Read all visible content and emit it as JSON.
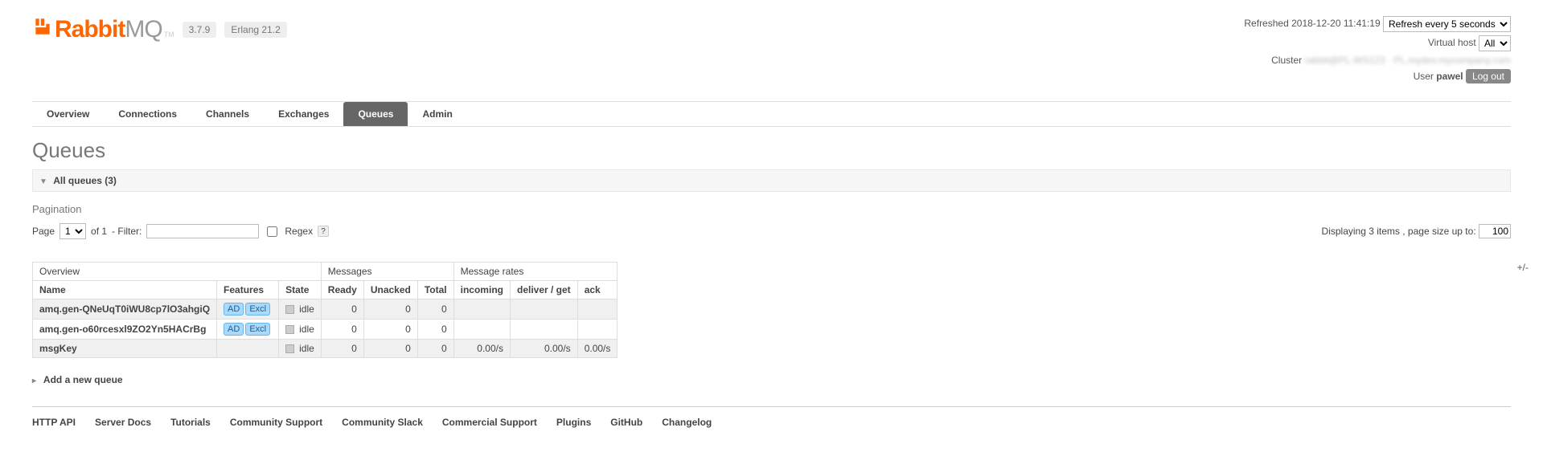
{
  "header": {
    "logoLeft": "Rabbit",
    "logoRight": "MQ",
    "tm": "TM",
    "versions": {
      "rabbit": "3.7.9",
      "erlang": "Erlang 21.2"
    },
    "refreshedPrefix": "Refreshed",
    "refreshedTime": "2018-12-20 11:41:19",
    "refreshOptions": [
      "Refresh every 5 seconds"
    ],
    "vhostLabel": "Virtual host",
    "vhostOptions": [
      "All"
    ],
    "clusterLabel": "Cluster",
    "clusterValue": "rabbit@PL-WS123 · PL.mydev.mycompany.com",
    "userLabel": "User",
    "userName": "pawel",
    "logout": "Log out"
  },
  "tabs": [
    "Overview",
    "Connections",
    "Channels",
    "Exchanges",
    "Queues",
    "Admin"
  ],
  "activeTab": "Queues",
  "pageTitle": "Queues",
  "allQueuesLabel": "All queues (3)",
  "paginationTitle": "Pagination",
  "pagination": {
    "pageLabel": "Page",
    "pageValue": "1",
    "ofLabel": "of 1",
    "filterLabel": "- Filter:",
    "filterValue": "",
    "regexLabel": "Regex",
    "displaying": "Displaying 3 items , page size up to:",
    "pageSize": "100"
  },
  "table": {
    "groups": {
      "overview": "Overview",
      "messages": "Messages",
      "rates": "Message rates"
    },
    "headers": {
      "name": "Name",
      "features": "Features",
      "state": "State",
      "ready": "Ready",
      "unacked": "Unacked",
      "total": "Total",
      "incoming": "incoming",
      "deliverGet": "deliver / get",
      "ack": "ack"
    },
    "plusMinus": "+/-",
    "rows": [
      {
        "name": "amq.gen-QNeUqT0iWU8cp7lO3ahgiQ",
        "features": [
          "AD",
          "Excl"
        ],
        "state": "idle",
        "ready": "0",
        "unacked": "0",
        "total": "0",
        "incoming": "",
        "deliverGet": "",
        "ack": ""
      },
      {
        "name": "amq.gen-o60rcesxl9ZO2Yn5HACrBg",
        "features": [
          "AD",
          "Excl"
        ],
        "state": "idle",
        "ready": "0",
        "unacked": "0",
        "total": "0",
        "incoming": "",
        "deliverGet": "",
        "ack": ""
      },
      {
        "name": "msgKey",
        "features": [],
        "state": "idle",
        "ready": "0",
        "unacked": "0",
        "total": "0",
        "incoming": "0.00/s",
        "deliverGet": "0.00/s",
        "ack": "0.00/s"
      }
    ]
  },
  "addQueue": "Add a new queue",
  "footer": [
    "HTTP API",
    "Server Docs",
    "Tutorials",
    "Community Support",
    "Community Slack",
    "Commercial Support",
    "Plugins",
    "GitHub",
    "Changelog"
  ]
}
